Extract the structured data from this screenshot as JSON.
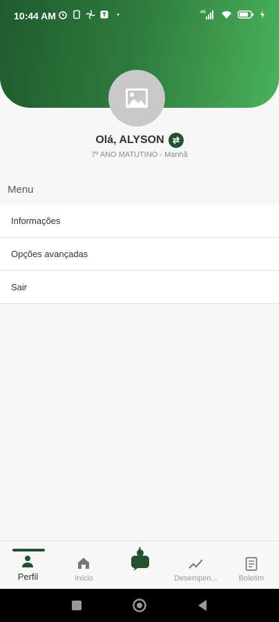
{
  "status_bar": {
    "time": "10:44 AM",
    "network": "4G",
    "icons_left": [
      "alarm-icon",
      "sim-icon",
      "fan-icon",
      "notification-icon",
      "dot-icon"
    ],
    "icons_right": [
      "signal-icon",
      "wifi-icon",
      "battery-icon",
      "charging-icon"
    ]
  },
  "profile": {
    "greeting": "Olá, ALYSON",
    "class_info": "7º ANO MATUTINO - Manhã"
  },
  "menu": {
    "title": "Menu",
    "items": [
      {
        "label": "Informações"
      },
      {
        "label": "Opções avançadas"
      },
      {
        "label": "Sair"
      }
    ]
  },
  "bottom_nav": {
    "items": [
      {
        "label": "Perfil",
        "icon": "person-icon",
        "active": true
      },
      {
        "label": "Início",
        "icon": "home-icon",
        "active": false
      },
      {
        "label": "",
        "icon": "apple-chat-icon",
        "active": false
      },
      {
        "label": "Desempen...",
        "icon": "trend-icon",
        "active": false
      },
      {
        "label": "Boletim",
        "icon": "document-icon",
        "active": false
      }
    ]
  },
  "colors": {
    "primary": "#24512f",
    "header_gradient_start": "#1f5a2e",
    "header_gradient_end": "#4ab25b"
  }
}
